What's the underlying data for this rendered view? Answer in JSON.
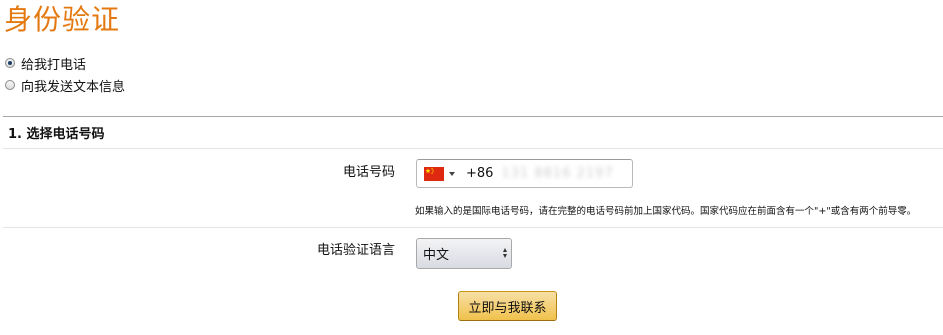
{
  "page": {
    "title": "身份验证"
  },
  "verification_method": {
    "options": [
      {
        "label": "给我打电话",
        "selected": true
      },
      {
        "label": "向我发送文本信息",
        "selected": false
      }
    ]
  },
  "section": {
    "title": "1. 选择电话号码"
  },
  "phone": {
    "label": "电话号码",
    "country_flag": "china-flag-icon",
    "dial_code": "+86",
    "number_masked": "131 8816 2197",
    "help_text": "如果输入的是国际电话号码，请在完整的电话号码前加上国家代码。国家代码应在前面含有一个\"+\"或含有两个前导零。"
  },
  "language": {
    "label": "电话验证语言",
    "selected": "中文"
  },
  "submit": {
    "label": "立即与我联系"
  },
  "colors": {
    "title": "#e47911",
    "button_top": "#f7dfa5",
    "button_bottom": "#f0c14b",
    "flag_red": "#de2910",
    "flag_star": "#ffde00"
  }
}
